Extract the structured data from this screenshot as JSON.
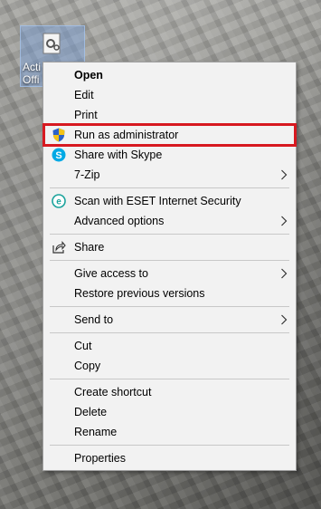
{
  "desktop": {
    "icon_caption": "Acti\nOffi"
  },
  "menu": {
    "open": "Open",
    "edit": "Edit",
    "print": "Print",
    "run_as_admin": "Run as administrator",
    "share_skype": "Share with Skype",
    "zip": "7-Zip",
    "eset_scan": "Scan with ESET Internet Security",
    "advanced_options": "Advanced options",
    "share": "Share",
    "give_access": "Give access to",
    "restore_versions": "Restore previous versions",
    "send_to": "Send to",
    "cut": "Cut",
    "copy": "Copy",
    "create_shortcut": "Create shortcut",
    "delete": "Delete",
    "rename": "Rename",
    "properties": "Properties"
  },
  "colors": {
    "highlight_border": "#d71920",
    "skype_blue": "#00a9e5",
    "eset_teal": "#1ba39c",
    "uac_blue": "#2a62c9",
    "uac_yellow": "#f3c316"
  }
}
